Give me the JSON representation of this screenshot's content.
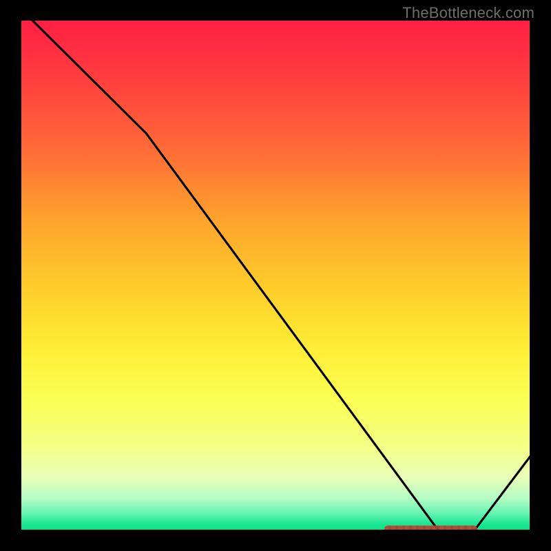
{
  "watermark": "TheBottleneck.com",
  "chart_data": {
    "type": "line",
    "title": "",
    "xlabel": "",
    "ylabel": "",
    "xlim": [
      0,
      100
    ],
    "ylim": [
      0,
      100
    ],
    "grid": false,
    "legend": false,
    "x": [
      0,
      3,
      25,
      82,
      88,
      100
    ],
    "y": [
      105,
      100,
      78,
      0,
      0,
      16
    ],
    "series_color": "#000000",
    "background_gradient": {
      "top": "#ff1f44",
      "mid": "#feee35",
      "bottom": "#00df7f",
      "meaning": "bottleneck severity"
    },
    "annotations": [
      {
        "type": "range_marker",
        "axis": "x",
        "start": 71,
        "end": 89,
        "y": 0,
        "color": "#c4402f",
        "label": ""
      }
    ]
  }
}
